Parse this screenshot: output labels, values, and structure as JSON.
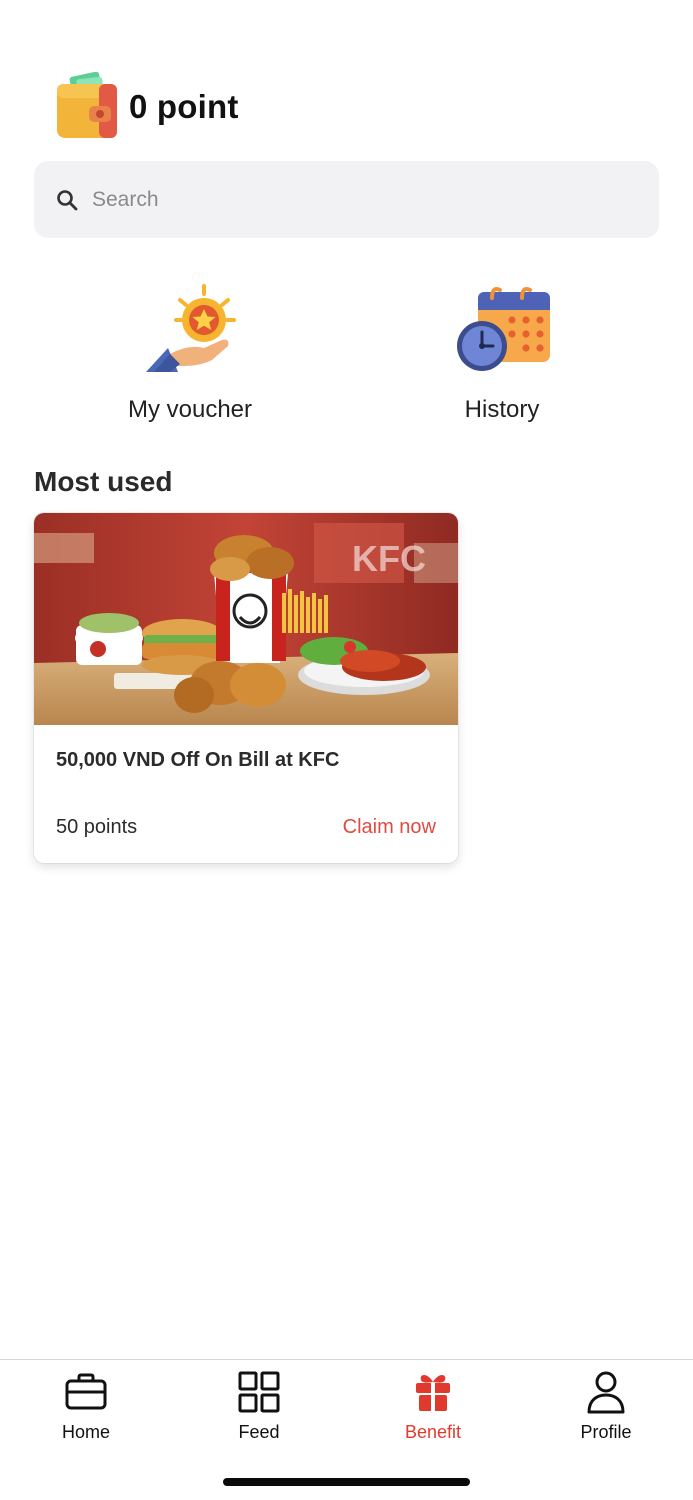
{
  "header": {
    "points_text": "0 point",
    "icon": "wallet-icon"
  },
  "search": {
    "placeholder": "Search",
    "value": "",
    "icon": "search-icon"
  },
  "quick_actions": [
    {
      "label": "My voucher",
      "icon": "voucher-hand-star-icon"
    },
    {
      "label": "History",
      "icon": "calendar-clock-icon"
    }
  ],
  "most_used": {
    "title": "Most used",
    "vouchers": [
      {
        "title": "50,000 VND Off On Bill at KFC",
        "points": "50 points",
        "action": "Claim now",
        "image": "kfc-meal-photo",
        "image_sign_text": "KFC"
      }
    ]
  },
  "bottom_nav": {
    "items": [
      {
        "label": "Home",
        "icon": "briefcase-icon",
        "active": false
      },
      {
        "label": "Feed",
        "icon": "grid-icon",
        "active": false
      },
      {
        "label": "Benefit",
        "icon": "gift-icon",
        "active": true
      },
      {
        "label": "Profile",
        "icon": "person-icon",
        "active": false
      }
    ]
  },
  "colors": {
    "accent": "#e03a2f",
    "claim": "#e04b42",
    "search_bg": "#f2f2f4",
    "text": "#1f1f1f"
  }
}
